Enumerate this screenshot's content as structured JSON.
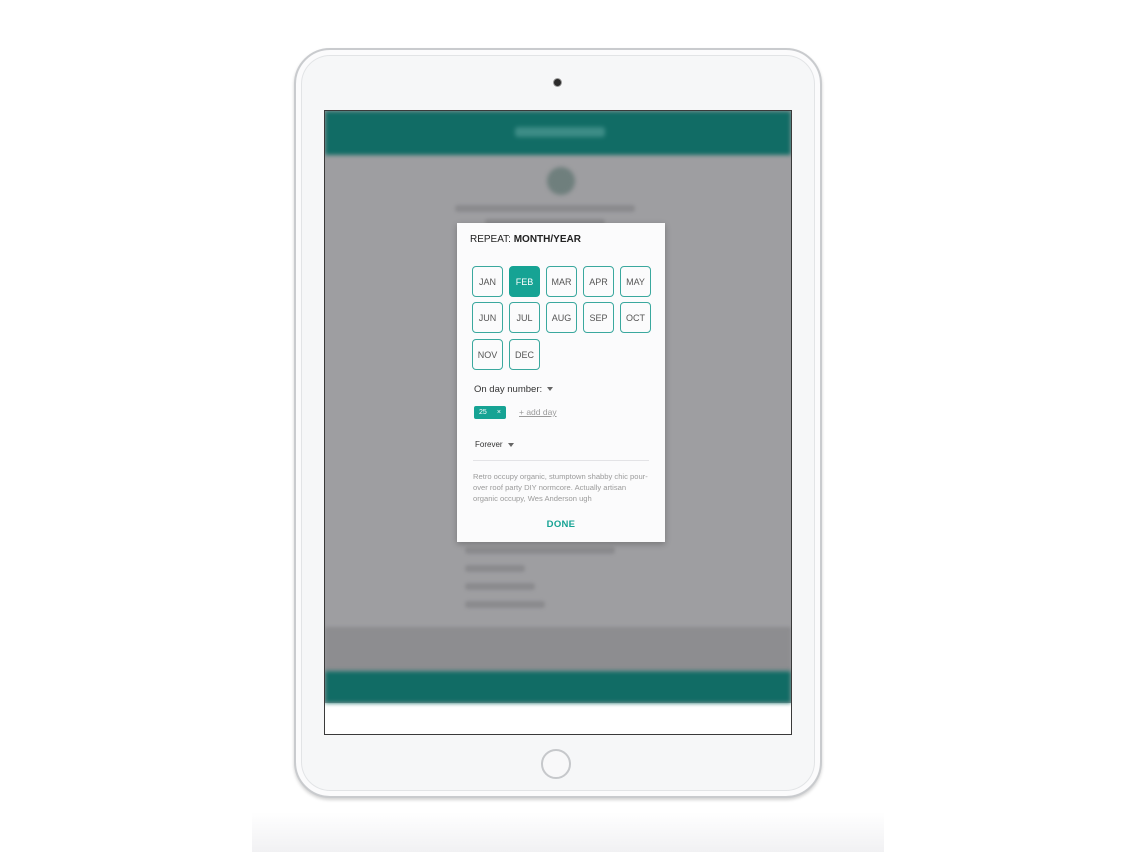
{
  "dialog": {
    "title_prefix": "REPEAT: ",
    "title_value": "MONTH/YEAR",
    "months": [
      "JAN",
      "FEB",
      "MAR",
      "APR",
      "MAY",
      "JUN",
      "JUL",
      "AUG",
      "SEP",
      "OCT",
      "NOV",
      "DEC"
    ],
    "selected_month": "FEB",
    "day_number_label": "On day number:",
    "day_chip_value": "25",
    "day_chip_remove": "×",
    "add_day_label": "+ add day",
    "duration_label": "Forever",
    "description": "Retro occupy organic, stumptown shabby chic pour-over roof party DIY normcore. Actually artisan organic occupy, Wes Anderson ugh",
    "done_label": "DONE"
  },
  "colors": {
    "accent": "#16a394",
    "app_header": "#116c65",
    "overlay": "#9e9ea1"
  },
  "icons": {
    "dropdown": "caret-down-icon",
    "remove": "close-icon"
  }
}
